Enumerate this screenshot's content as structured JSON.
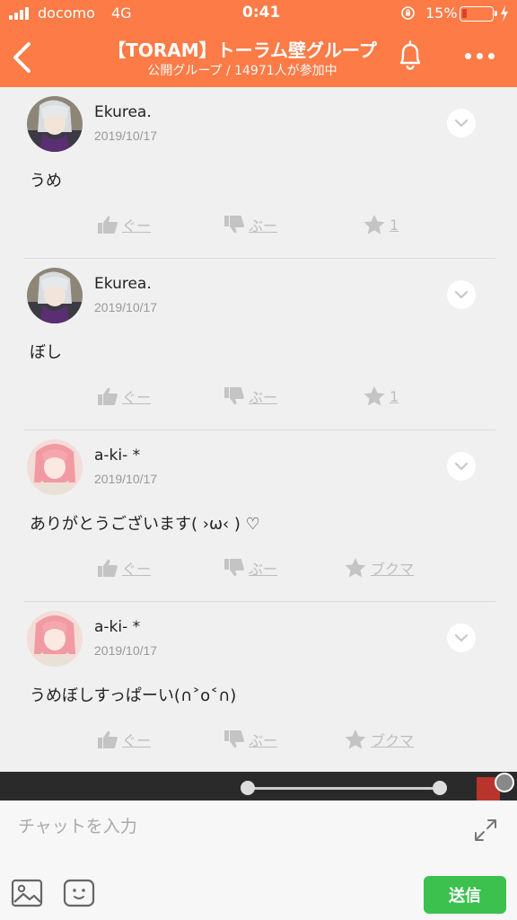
{
  "status_bar": {
    "carrier": "docomo",
    "network": "4G",
    "time": "0:41",
    "battery": "15%",
    "battery_level": 0.15,
    "battery_color": "#e63b2e"
  },
  "header": {
    "title": "【TORAM】トーラム壁グループ",
    "subtitle": "公開グループ / 14971人が参加中",
    "background": "#fc7b47",
    "icons": [
      "chevron-left-icon",
      "bell-icon",
      "more-icon"
    ]
  },
  "comments": [
    {
      "author": "Ekurea.",
      "date": "2019/10/17",
      "text": "うめ",
      "good_label": "ぐー",
      "bad_label": "ぶー",
      "fav_label": "1",
      "avatar": "ekurea"
    },
    {
      "author": "Ekurea.",
      "date": "2019/10/17",
      "text": "ぼし",
      "good_label": "ぐー",
      "bad_label": "ぶー",
      "fav_label": "1",
      "avatar": "ekurea"
    },
    {
      "author": "a-ki- *",
      "date": "2019/10/17",
      "text": "ありがとうございます(  ›ω‹ ) ♡",
      "good_label": "ぐー",
      "bad_label": "ぶー",
      "fav_label": "ブクマ",
      "avatar": "aki"
    },
    {
      "author": "a-ki- *",
      "date": "2019/10/17",
      "text": "うめぼしすっぱーい(∩˃o˂∩)",
      "good_label": "ぐー",
      "bad_label": "ぶー",
      "fav_label": "ブクマ",
      "avatar": "aki"
    }
  ],
  "composer": {
    "placeholder": "チャットを入力",
    "send_label": "送信",
    "send_color": "#3cc14f",
    "icons": [
      "expand-icon",
      "image-icon",
      "sticker-icon"
    ]
  }
}
